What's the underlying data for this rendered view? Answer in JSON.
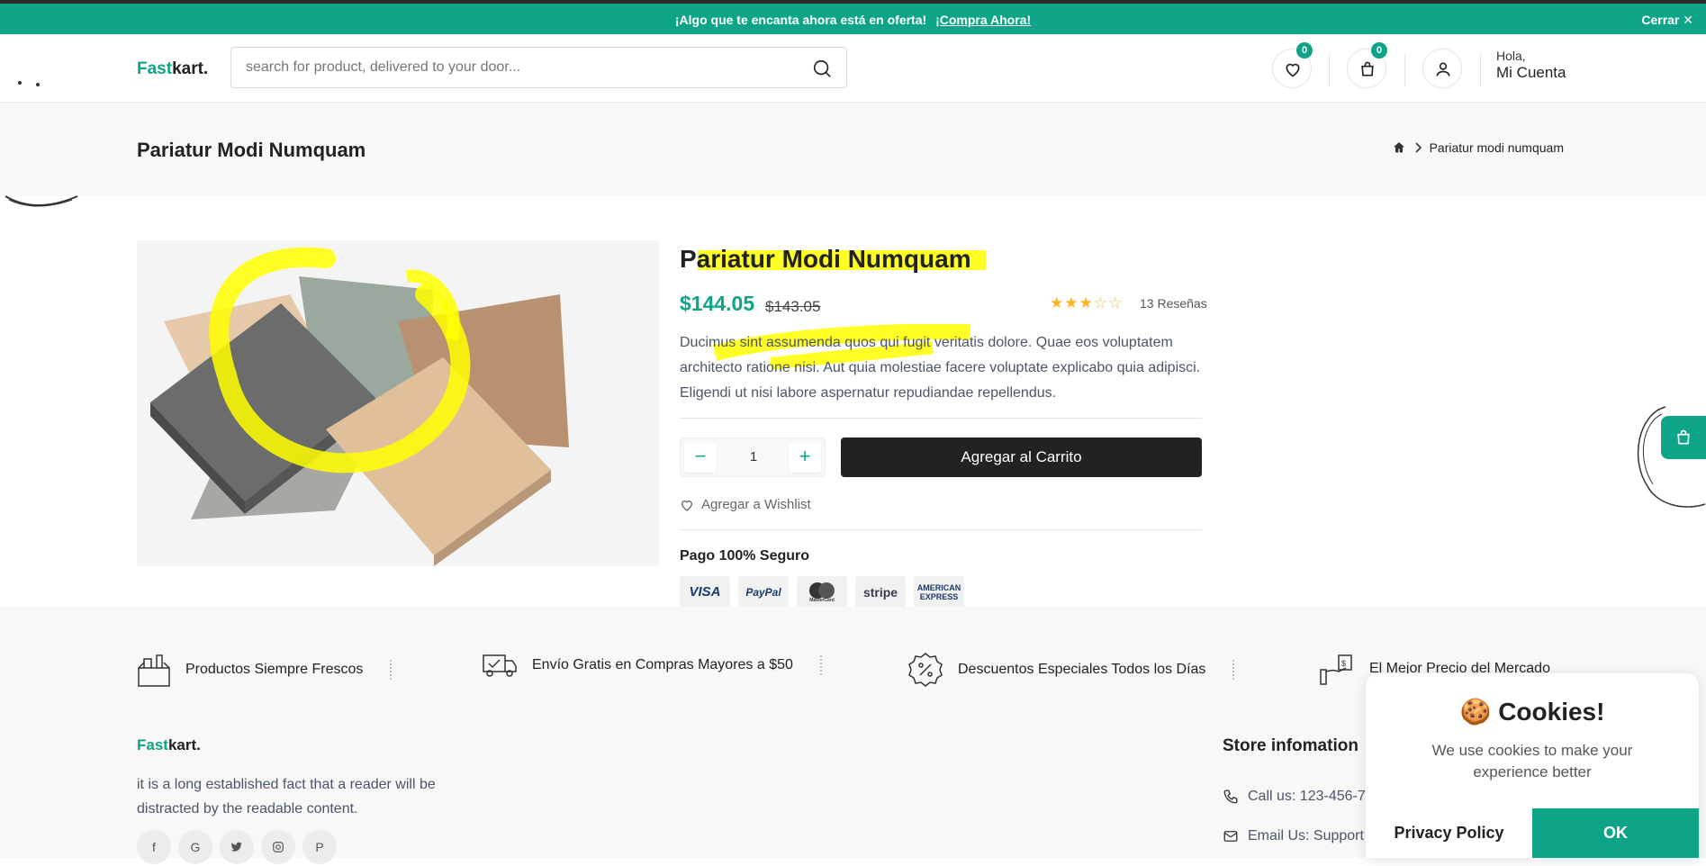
{
  "promo": {
    "text": "¡Algo que te encanta ahora está en oferta!",
    "link": "¡Compra Ahora!",
    "close": "Cerrar ✕"
  },
  "header": {
    "logo_accent": "Fast",
    "logo_rest": "kart.",
    "search_placeholder": "search for product, delivered to your door...",
    "wishlist_count": "0",
    "cart_count": "0",
    "greeting": "Hola,",
    "account": "Mi Cuenta"
  },
  "breadcrumb": {
    "title": "Pariatur Modi Numquam",
    "current": "Pariatur modi numquam"
  },
  "product": {
    "title": "Pariatur Modi Numquam",
    "price": "$144.05",
    "old_price": "$143.05",
    "rating": 3,
    "rating_max": 5,
    "reviews": "13 Reseñas",
    "description": "Ducimus sint assumenda quos qui fugit veritatis dolore. Quae eos voluptatem architecto ratione nisi. Aut quia molestiae facere voluptate explicabo quia adipisci. Eligendi ut nisi labore aspernatur repudiandae repellendus.",
    "quantity": "1",
    "minus": "−",
    "plus": "+",
    "add_to_cart": "Agregar al Carrito",
    "wishlist": "Agregar a Wishlist",
    "secure_title": "Pago 100% Seguro",
    "payments": [
      "VISA",
      "PayPal",
      "MasterCard",
      "stripe",
      "AMERICAN EXPRESS"
    ]
  },
  "services": [
    {
      "label": "Productos Siempre Frescos",
      "icon": "grocery-bag-icon"
    },
    {
      "label": "Envío Gratis en Compras Mayores a $50",
      "icon": "delivery-truck-icon"
    },
    {
      "label": "Descuentos Especiales Todos los Días",
      "icon": "discount-badge-icon"
    },
    {
      "label": "El Mejor Precio del Mercado",
      "icon": "price-tag-hand-icon"
    }
  ],
  "footer": {
    "logo_accent": "Fast",
    "logo_rest": "kart.",
    "about": "it is a long established fact that a reader will be distracted by the readable content.",
    "store_title": "Store infomation",
    "call": "Call us: 123-456-7",
    "email": "Email Us: Support"
  },
  "cookie": {
    "title": "🍪 Cookies!",
    "text": "We use cookies to make your experience better",
    "policy": "Privacy Policy",
    "ok": "OK"
  },
  "colors": {
    "brand": "#0da487",
    "dark_button": "#222222",
    "highlight": "#ffff00",
    "star": "#ffb321"
  }
}
